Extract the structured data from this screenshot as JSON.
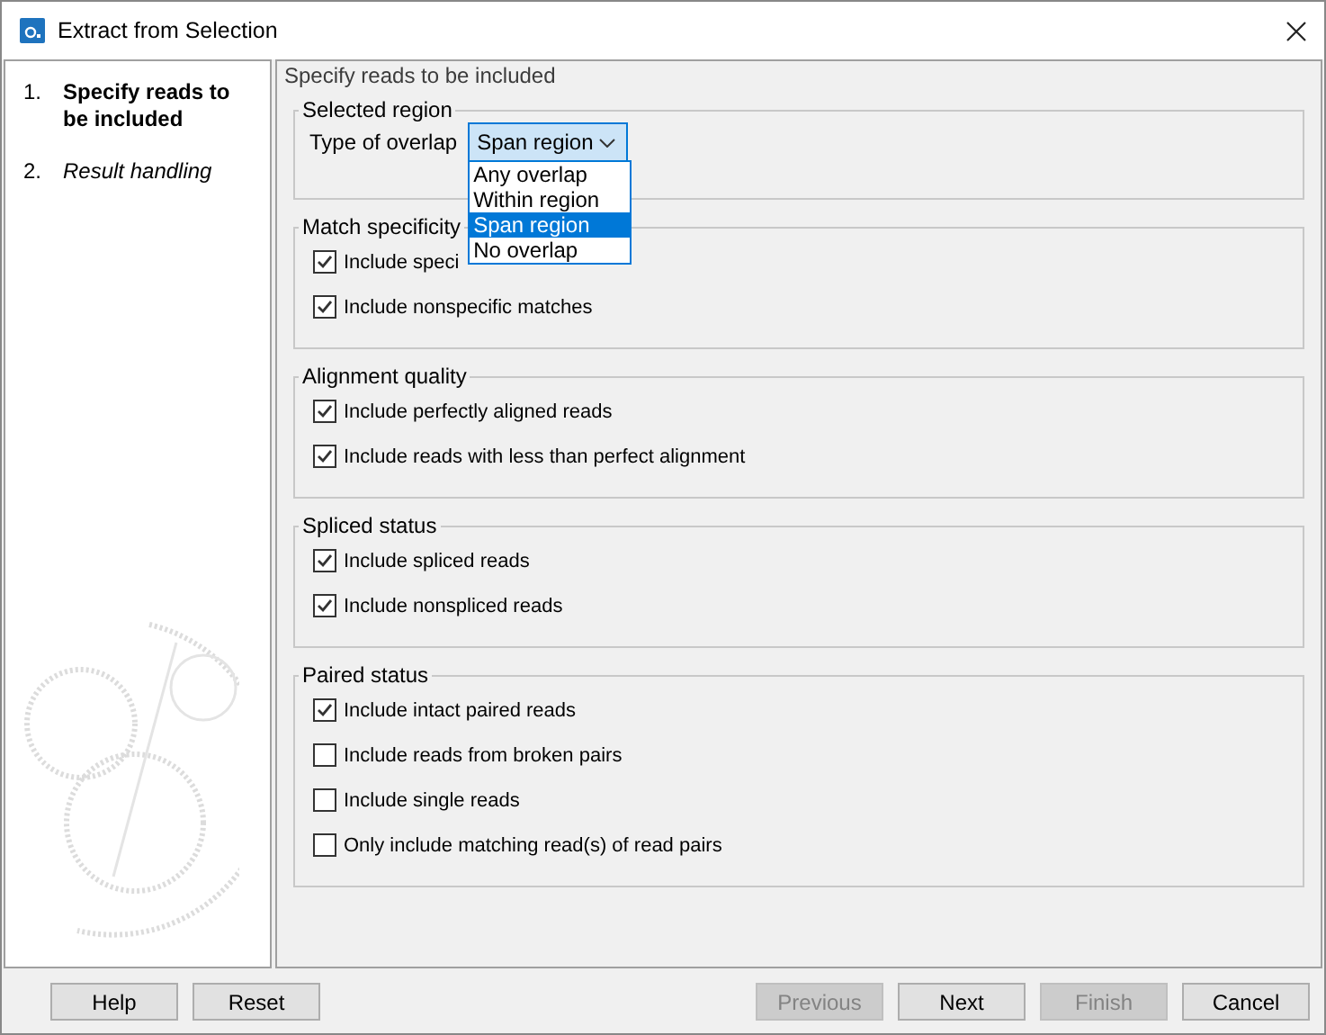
{
  "window": {
    "title": "Extract from Selection"
  },
  "steps": [
    {
      "number": "1.",
      "label": "Specify reads to be included",
      "selected": true
    },
    {
      "number": "2.",
      "label": "Result handling",
      "selected": false
    }
  ],
  "panel_title": "Specify reads to be included",
  "groups": [
    {
      "title": "Selected region",
      "kind": "combo",
      "label": "Type of overlap",
      "value": "Span region",
      "expanded": true,
      "options": [
        {
          "label": "Any overlap",
          "selected": false
        },
        {
          "label": "Within region",
          "selected": false
        },
        {
          "label": "Span region",
          "selected": true
        },
        {
          "label": "No overlap",
          "selected": false
        }
      ]
    },
    {
      "title": "Match specificity",
      "kind": "checks",
      "items": [
        {
          "label": "Include speci",
          "checked": true
        },
        {
          "label": "Include nonspecific matches",
          "checked": true
        }
      ]
    },
    {
      "title": "Alignment quality",
      "kind": "checks",
      "items": [
        {
          "label": "Include perfectly aligned reads",
          "checked": true
        },
        {
          "label": "Include reads with less than perfect alignment",
          "checked": true
        }
      ]
    },
    {
      "title": "Spliced status",
      "kind": "checks",
      "items": [
        {
          "label": "Include spliced reads",
          "checked": true
        },
        {
          "label": "Include nonspliced reads",
          "checked": true
        }
      ]
    },
    {
      "title": "Paired status",
      "kind": "checks",
      "items": [
        {
          "label": "Include intact paired reads",
          "checked": true
        },
        {
          "label": "Include reads from broken pairs",
          "checked": false
        },
        {
          "label": "Include single reads",
          "checked": false
        },
        {
          "label": "Only include matching read(s) of read pairs",
          "checked": false
        }
      ]
    }
  ],
  "left_buttons": [
    {
      "label": "Help",
      "disabled": false
    },
    {
      "label": "Reset",
      "disabled": false
    }
  ],
  "right_buttons": [
    {
      "label": "Previous",
      "disabled": true
    },
    {
      "label": "Next",
      "disabled": false
    },
    {
      "label": "Finish",
      "disabled": true
    },
    {
      "label": "Cancel",
      "disabled": false
    }
  ]
}
